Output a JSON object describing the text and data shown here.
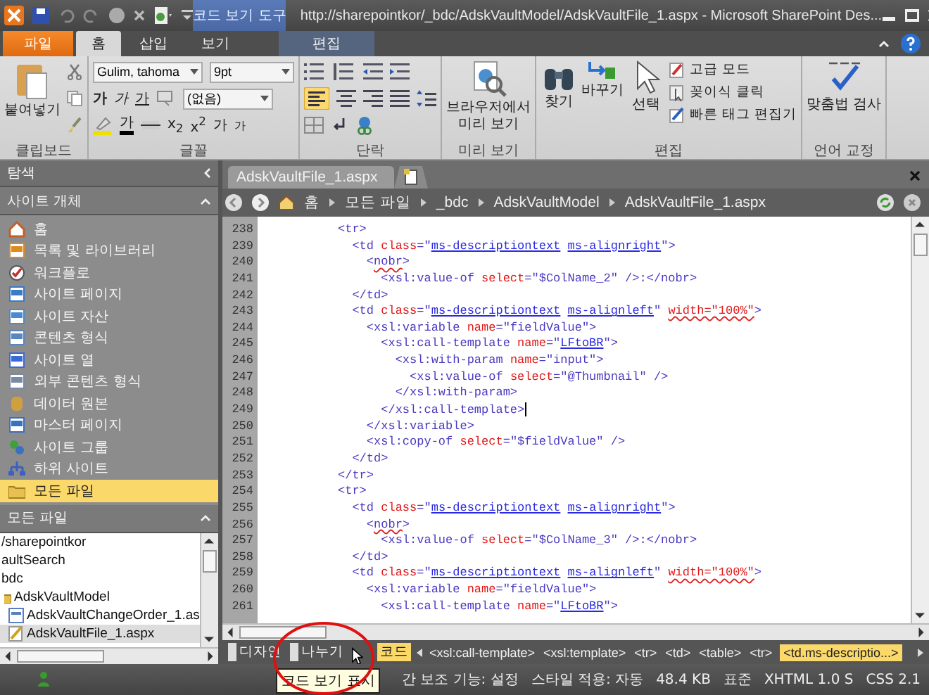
{
  "window": {
    "context_tab": "코드 보기 도구",
    "title": "http://sharepointkor/_bdc/AdskVaultModel/AdskVaultFile_1.aspx  -  Microsoft SharePoint Des..."
  },
  "tabs": [
    {
      "label": "파일",
      "kind": "file",
      "selected": false
    },
    {
      "label": "홈",
      "kind": "normal",
      "selected": true
    },
    {
      "label": "삽입",
      "kind": "normal",
      "selected": false
    },
    {
      "label": "보기",
      "kind": "normal",
      "selected": false
    },
    {
      "label": "편집",
      "kind": "contextual",
      "selected": false
    }
  ],
  "ribbon": {
    "clipboard": {
      "label": "클립보드",
      "paste": "붙여넣기"
    },
    "font": {
      "label": "글꼴",
      "font_name": "Gulim, tahoma",
      "font_size": "9pt",
      "style": "(없음)",
      "bold": "가",
      "italic": "가",
      "underline": "가",
      "font_color": "가",
      "subscript": "x$_{2}$",
      "superscript": "x$^{2}$",
      "grow": "가",
      "shrink": "가"
    },
    "paragraph": {
      "label": "단락"
    },
    "preview": {
      "label": "미리 보기",
      "button": "브라우저에서 미리 보기"
    },
    "editing": {
      "label": "편집",
      "find": "찾기",
      "replace": "바꾸기",
      "select": "선택",
      "advanced": "고급 모드",
      "skewer": "꽂이식 클릭",
      "quick_tag": "빠른 태그 편집기"
    },
    "proofing": {
      "label": "언어 교정",
      "button": "맞춤법 검사"
    }
  },
  "navigation": {
    "title": "탐색",
    "section": "사이트 개체",
    "items": [
      {
        "label": "홈",
        "selected": false
      },
      {
        "label": "목록 및 라이브러리",
        "selected": false
      },
      {
        "label": "워크플로",
        "selected": false
      },
      {
        "label": "사이트 페이지",
        "selected": false
      },
      {
        "label": "사이트 자산",
        "selected": false
      },
      {
        "label": "콘텐츠 형식",
        "selected": false
      },
      {
        "label": "사이트 열",
        "selected": false
      },
      {
        "label": "외부 콘텐츠 형식",
        "selected": false
      },
      {
        "label": "데이터 원본",
        "selected": false
      },
      {
        "label": "마스터 페이지",
        "selected": false
      },
      {
        "label": "사이트 그룹",
        "selected": false
      },
      {
        "label": "하위 사이트",
        "selected": false
      },
      {
        "label": "모든 파일",
        "selected": true
      }
    ],
    "files_section": "모든 파일",
    "tree": [
      {
        "label": "/sharepointkor",
        "selected": false
      },
      {
        "label": "aultSearch",
        "selected": false
      },
      {
        "label": "bdc",
        "selected": false,
        "children": [
          {
            "label": "AdskVaultModel",
            "kind": "folder",
            "selected": false,
            "children": [
              {
                "label": "AdskVaultChangeOrder_1.as",
                "kind": "page",
                "selected": false
              },
              {
                "label": "AdskVaultFile_1.aspx",
                "kind": "edit",
                "selected": true
              }
            ]
          }
        ]
      }
    ]
  },
  "editor": {
    "tabs": [
      {
        "label": "AdskVaultFile_1.aspx",
        "selected": true
      }
    ],
    "breadcrumb": [
      "홈",
      "모든 파일",
      "_bdc",
      "AdskVaultModel",
      "AdskVaultFile_1.aspx"
    ],
    "lines": [
      {
        "number": "238",
        "has_cursor": false,
        "segments": [
          {
            "kind": "tag",
            "text": "          <tr>"
          }
        ]
      },
      {
        "number": "239",
        "has_cursor": false,
        "segments": [
          {
            "kind": "tag",
            "text": "            <td "
          },
          {
            "kind": "attr",
            "text": "class"
          },
          {
            "kind": "tag",
            "text": "=\""
          },
          {
            "kind": "link",
            "text": "ms-descriptiontext"
          },
          {
            "kind": "link",
            "text": " ms-alignright"
          },
          {
            "kind": "tag",
            "text": "\">"
          }
        ]
      },
      {
        "number": "240",
        "has_cursor": false,
        "segments": [
          {
            "kind": "tag",
            "text": "              <"
          },
          {
            "kind": "tag-misspelled",
            "text": "nobr"
          },
          {
            "kind": "tag",
            "text": ">"
          }
        ]
      },
      {
        "number": "241",
        "has_cursor": false,
        "segments": [
          {
            "kind": "tag",
            "text": "                <xsl:value-of "
          },
          {
            "kind": "attr",
            "text": "select"
          },
          {
            "kind": "tag",
            "text": "=\"$ColName_2\" />:</nobr>"
          }
        ]
      },
      {
        "number": "242",
        "has_cursor": false,
        "segments": [
          {
            "kind": "tag",
            "text": "            </td>"
          }
        ]
      },
      {
        "number": "243",
        "has_cursor": false,
        "segments": [
          {
            "kind": "tag",
            "text": "            <td "
          },
          {
            "kind": "attr",
            "text": "class"
          },
          {
            "kind": "tag",
            "text": "=\""
          },
          {
            "kind": "link",
            "text": "ms-descriptiontext"
          },
          {
            "kind": "link",
            "text": " ms-alignleft"
          },
          {
            "kind": "tag",
            "text": "\" "
          },
          {
            "kind": "attr-misspelled",
            "text": "width=\"100%\""
          },
          {
            "kind": "tag",
            "text": ">"
          }
        ]
      },
      {
        "number": "244",
        "has_cursor": false,
        "segments": [
          {
            "kind": "tag",
            "text": "              <xsl:variable "
          },
          {
            "kind": "attr",
            "text": "name"
          },
          {
            "kind": "tag",
            "text": "=\"fieldValue\">"
          }
        ]
      },
      {
        "number": "245",
        "has_cursor": false,
        "segments": [
          {
            "kind": "tag",
            "text": "                <xsl:call-template "
          },
          {
            "kind": "attr",
            "text": "name"
          },
          {
            "kind": "tag",
            "text": "=\""
          },
          {
            "kind": "link",
            "text": "LFtoBR"
          },
          {
            "kind": "tag",
            "text": "\">"
          }
        ]
      },
      {
        "number": "246",
        "has_cursor": false,
        "segments": [
          {
            "kind": "tag",
            "text": "                  <xsl:with-param "
          },
          {
            "kind": "attr",
            "text": "name"
          },
          {
            "kind": "tag",
            "text": "=\"input\">"
          }
        ]
      },
      {
        "number": "247",
        "has_cursor": false,
        "segments": [
          {
            "kind": "tag",
            "text": "                    <xsl:value-of "
          },
          {
            "kind": "attr",
            "text": "select"
          },
          {
            "kind": "tag",
            "text": "=\"@Thumbnail\" />"
          }
        ]
      },
      {
        "number": "248",
        "has_cursor": false,
        "segments": [
          {
            "kind": "tag",
            "text": "                  </xsl:with-param>"
          }
        ]
      },
      {
        "number": "249",
        "has_cursor": true,
        "segments": [
          {
            "kind": "tag",
            "text": "                </xsl:call-template>"
          }
        ]
      },
      {
        "number": "250",
        "has_cursor": false,
        "segments": [
          {
            "kind": "tag",
            "text": "              </xsl:variable>"
          }
        ]
      },
      {
        "number": "251",
        "has_cursor": false,
        "segments": [
          {
            "kind": "tag",
            "text": "              <xsl:copy-of "
          },
          {
            "kind": "attr",
            "text": "select"
          },
          {
            "kind": "tag",
            "text": "=\"$fieldValue\" />"
          }
        ]
      },
      {
        "number": "252",
        "has_cursor": false,
        "segments": [
          {
            "kind": "tag",
            "text": "            </td>"
          }
        ]
      },
      {
        "number": "253",
        "has_cursor": false,
        "segments": [
          {
            "kind": "tag",
            "text": "          </tr>"
          }
        ]
      },
      {
        "number": "254",
        "has_cursor": false,
        "segments": [
          {
            "kind": "tag",
            "text": "          <tr>"
          }
        ]
      },
      {
        "number": "255",
        "has_cursor": false,
        "segments": [
          {
            "kind": "tag",
            "text": "            <td "
          },
          {
            "kind": "attr",
            "text": "class"
          },
          {
            "kind": "tag",
            "text": "=\""
          },
          {
            "kind": "link",
            "text": "ms-descriptiontext"
          },
          {
            "kind": "link",
            "text": " ms-alignright"
          },
          {
            "kind": "tag",
            "text": "\">"
          }
        ]
      },
      {
        "number": "256",
        "has_cursor": false,
        "segments": [
          {
            "kind": "tag",
            "text": "              <"
          },
          {
            "kind": "tag-misspelled",
            "text": "nobr"
          },
          {
            "kind": "tag",
            "text": ">"
          }
        ]
      },
      {
        "number": "257",
        "has_cursor": false,
        "segments": [
          {
            "kind": "tag",
            "text": "                <xsl:value-of "
          },
          {
            "kind": "attr",
            "text": "select"
          },
          {
            "kind": "tag",
            "text": "=\"$ColName_3\" />:</nobr>"
          }
        ]
      },
      {
        "number": "258",
        "has_cursor": false,
        "segments": [
          {
            "kind": "tag",
            "text": "            </td>"
          }
        ]
      },
      {
        "number": "259",
        "has_cursor": false,
        "segments": [
          {
            "kind": "tag",
            "text": "            <td "
          },
          {
            "kind": "attr",
            "text": "class"
          },
          {
            "kind": "tag",
            "text": "=\""
          },
          {
            "kind": "link",
            "text": "ms-descriptiontext"
          },
          {
            "kind": "link",
            "text": " ms-alignleft"
          },
          {
            "kind": "tag",
            "text": "\" "
          },
          {
            "kind": "attr-misspelled",
            "text": "width=\"100%\""
          },
          {
            "kind": "tag",
            "text": ">"
          }
        ]
      },
      {
        "number": "260",
        "has_cursor": false,
        "segments": [
          {
            "kind": "tag",
            "text": "              <xsl:variable "
          },
          {
            "kind": "attr",
            "text": "name"
          },
          {
            "kind": "tag",
            "text": "=\"fieldValue\">"
          }
        ]
      },
      {
        "number": "261",
        "has_cursor": false,
        "segments": [
          {
            "kind": "tag",
            "text": "                <xsl:call-template "
          },
          {
            "kind": "attr",
            "text": "name"
          },
          {
            "kind": "tag",
            "text": "=\""
          },
          {
            "kind": "link",
            "text": "LFtoBR"
          },
          {
            "kind": "tag",
            "text": "\">"
          }
        ]
      }
    ],
    "views": [
      {
        "label": "디자인",
        "selected": false
      },
      {
        "label": "나누기",
        "selected": false
      },
      {
        "label": "코드",
        "selected": true
      }
    ],
    "tag_path": [
      {
        "label": "<xsl:call-template>",
        "selected": false
      },
      {
        "label": "<xsl:template>",
        "selected": false
      },
      {
        "label": "<tr>",
        "selected": false
      },
      {
        "label": "<td>",
        "selected": false
      },
      {
        "label": "<table>",
        "selected": false
      },
      {
        "label": "<tr>",
        "selected": false
      },
      {
        "label": "<td.ms-descriptio...>",
        "selected": true
      }
    ],
    "tooltip": "코드 보기 표시"
  },
  "status_bar": [
    "간 보조 기능: 설정",
    "스타일 적용: 자동",
    "48.4 KB",
    "표준",
    "XHTML 1.0 S",
    "CSS 2.1"
  ]
}
